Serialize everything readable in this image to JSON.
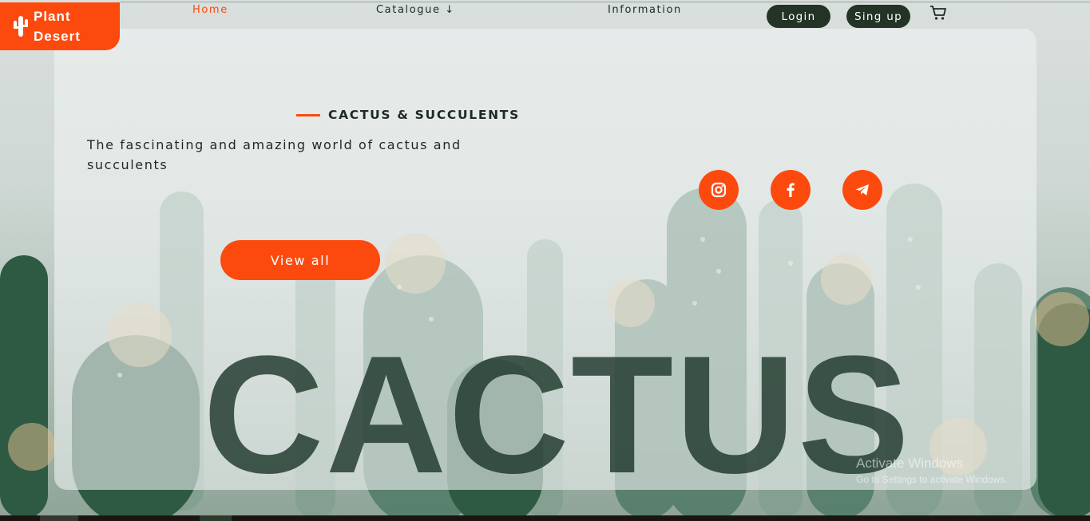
{
  "brand": {
    "name_line1": "Plant",
    "name_line2": "Desert",
    "icon": "cactus-icon",
    "color": "#fc4a0f"
  },
  "nav": {
    "home": "Home",
    "catalogue": "Catalogue ↓",
    "information": "Information",
    "active": "Home"
  },
  "auth": {
    "login": "Login",
    "signup": "Sing up"
  },
  "cart": {
    "icon": "cart-icon"
  },
  "hero": {
    "eyebrow": "CACTUS & SUCCULENTS",
    "tagline": "The fascinating and amazing world of cactus and succulents",
    "cta": "View all",
    "big_word": "CACTUS"
  },
  "social": [
    {
      "icon": "instagram-icon"
    },
    {
      "icon": "facebook-icon"
    },
    {
      "icon": "telegram-icon"
    }
  ],
  "watermark": {
    "line1": "Activate Windows",
    "line2": "Go to Settings to activate Windows."
  },
  "colors": {
    "accent": "#fc4a0f",
    "dark": "#233326",
    "text": "#1e2a22"
  }
}
